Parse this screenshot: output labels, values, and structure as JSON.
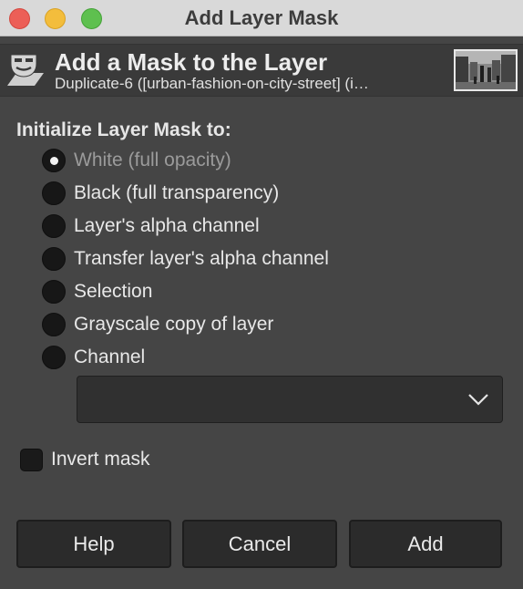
{
  "window": {
    "title": "Add Layer Mask",
    "controls": [
      "close",
      "minimize",
      "maximize"
    ]
  },
  "header": {
    "icon": "layer-mask-icon",
    "title": "Add a Mask to the Layer",
    "subtitle": "Duplicate-6 ([urban-fashion-on-city-street] (i…"
  },
  "init_section": {
    "label": "Initialize Layer Mask to:",
    "options": [
      {
        "label": "White (full opacity)",
        "selected": true
      },
      {
        "label": "Black (full transparency)",
        "selected": false
      },
      {
        "label": "Layer's alpha channel",
        "selected": false
      },
      {
        "label": "Transfer layer's alpha channel",
        "selected": false
      },
      {
        "label": "Selection",
        "selected": false
      },
      {
        "label": "Grayscale copy of layer",
        "selected": false
      },
      {
        "label": "Channel",
        "selected": false
      }
    ],
    "channel_select_value": ""
  },
  "invert": {
    "label": "Invert mask",
    "checked": false
  },
  "buttons": {
    "help": "Help",
    "cancel": "Cancel",
    "add": "Add"
  }
}
